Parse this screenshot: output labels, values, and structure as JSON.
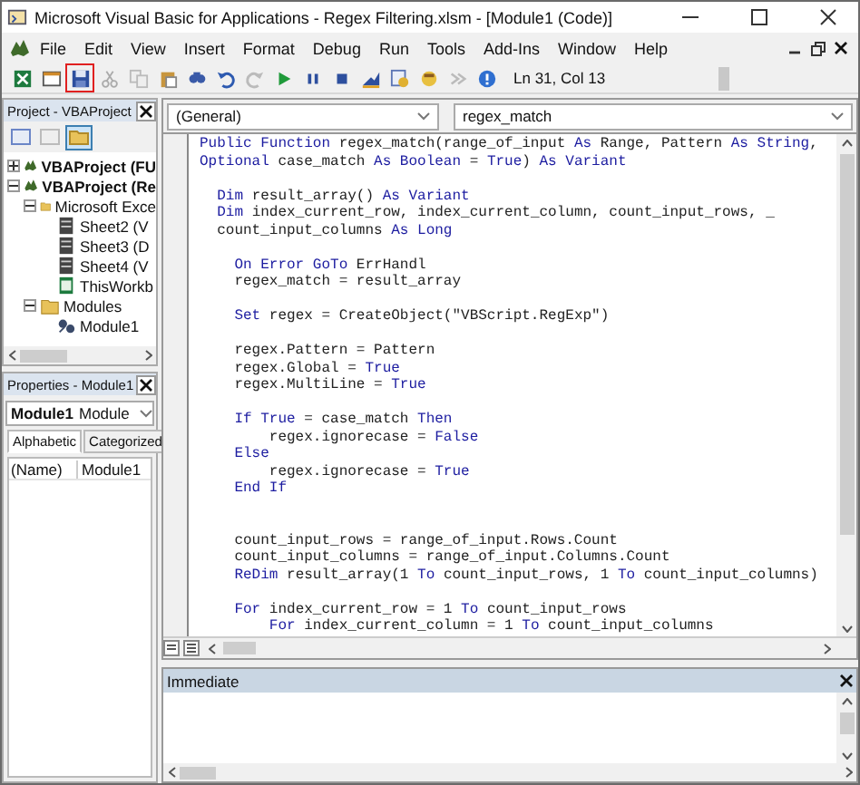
{
  "window": {
    "title": "Microsoft Visual Basic for Applications - Regex Filtering.xlsm - [Module1 (Code)]"
  },
  "menu": [
    "File",
    "Edit",
    "View",
    "Insert",
    "Format",
    "Debug",
    "Run",
    "Tools",
    "Add-Ins",
    "Window",
    "Help"
  ],
  "toolbar": {
    "items": [
      {
        "kind": "excel",
        "highlighted": false
      },
      {
        "kind": "form",
        "highlighted": false
      },
      {
        "kind": "save",
        "highlighted": true
      },
      {
        "kind": "cut",
        "highlighted": false
      },
      {
        "kind": "copy",
        "highlighted": false
      },
      {
        "kind": "paste",
        "highlighted": false
      },
      {
        "kind": "find",
        "highlighted": false
      },
      {
        "kind": "undo",
        "highlighted": false
      },
      {
        "kind": "redo",
        "highlighted": false
      },
      {
        "kind": "run",
        "highlighted": false
      },
      {
        "kind": "pause",
        "highlighted": false
      },
      {
        "kind": "stop",
        "highlighted": false
      },
      {
        "kind": "design",
        "highlighted": false
      },
      {
        "kind": "explorer",
        "highlighted": false
      },
      {
        "kind": "toolbox",
        "highlighted": false
      },
      {
        "kind": "browser",
        "highlighted": false
      },
      {
        "kind": "help",
        "highlighted": false
      }
    ],
    "position": "Ln 31, Col 13"
  },
  "project": {
    "title": "Project - VBAProject",
    "tree": [
      {
        "label": "VBAProject (FU",
        "kind": "project",
        "expanded": false
      },
      {
        "label": "VBAProject (Re",
        "kind": "project",
        "expanded": true,
        "children": [
          {
            "label": "Microsoft Exce",
            "kind": "folder",
            "expanded": true,
            "children": [
              {
                "label": "Sheet2 (V",
                "kind": "sheet"
              },
              {
                "label": "Sheet3 (D",
                "kind": "sheet"
              },
              {
                "label": "Sheet4 (V",
                "kind": "sheet"
              },
              {
                "label": "ThisWorkb",
                "kind": "workbook"
              }
            ]
          },
          {
            "label": "Modules",
            "kind": "folder",
            "expanded": true,
            "children": [
              {
                "label": "Module1",
                "kind": "module"
              }
            ]
          }
        ]
      }
    ]
  },
  "properties": {
    "title": "Properties - Module1",
    "object": {
      "name": "Module1",
      "type": "Module"
    },
    "tabs": [
      {
        "label": "Alphabetic",
        "selected": true
      },
      {
        "label": "Categorized",
        "selected": false
      }
    ],
    "rows": [
      {
        "name": "(Name)",
        "value": "Module1"
      }
    ]
  },
  "code_window": {
    "object_combo": "(General)",
    "procedure_combo": "regex_match",
    "blocks": [
      {
        "lines": [
          [
            {
              "text": "Public Function",
              "kind": "keyword"
            },
            {
              "text": " regex_match(range_of_input ",
              "kind": "plain"
            },
            {
              "text": "As",
              "kind": "keyword"
            },
            {
              "text": " Range, Pattern ",
              "kind": "plain"
            },
            {
              "text": "As String",
              "kind": "keyword"
            },
            {
              "text": ",",
              "kind": "plain"
            }
          ],
          [
            {
              "text": "Optional",
              "kind": "keyword"
            },
            {
              "text": " case_match ",
              "kind": "plain"
            },
            {
              "text": "As Boolean",
              "kind": "keyword"
            },
            {
              "text": " = ",
              "kind": "plain"
            },
            {
              "text": "True",
              "kind": "keyword"
            },
            {
              "text": ") ",
              "kind": "plain"
            },
            {
              "text": "As Variant",
              "kind": "keyword"
            }
          ]
        ]
      },
      {
        "lines": [
          [
            {
              "text": "  Dim",
              "kind": "keyword"
            },
            {
              "text": " result_array() ",
              "kind": "plain"
            },
            {
              "text": "As Variant",
              "kind": "keyword"
            }
          ],
          [
            {
              "text": "  Dim",
              "kind": "keyword"
            },
            {
              "text": " index_current_row, index_current_column, count_input_rows, _",
              "kind": "plain"
            }
          ],
          [
            {
              "text": "  count_input_columns ",
              "kind": "plain"
            },
            {
              "text": "As Long",
              "kind": "keyword"
            }
          ]
        ]
      },
      {
        "lines": [
          [
            {
              "text": "    On Error GoTo",
              "kind": "keyword"
            },
            {
              "text": " ErrHandl",
              "kind": "plain"
            }
          ],
          [
            {
              "text": "    regex_match = result_array",
              "kind": "plain"
            }
          ]
        ]
      },
      {
        "lines": [
          [
            {
              "text": "    Set",
              "kind": "keyword"
            },
            {
              "text": " regex = CreateObject(\"VBScript.RegExp\")",
              "kind": "plain"
            }
          ]
        ]
      },
      {
        "lines": [
          [
            {
              "text": "    regex.Pattern = Pattern",
              "kind": "plain"
            }
          ],
          [
            {
              "text": "    regex.Global = ",
              "kind": "plain"
            },
            {
              "text": "True",
              "kind": "keyword"
            }
          ],
          [
            {
              "text": "    regex.MultiLine = ",
              "kind": "plain"
            },
            {
              "text": "True",
              "kind": "keyword"
            }
          ]
        ]
      },
      {
        "lines": [
          [
            {
              "text": "    If True",
              "kind": "keyword"
            },
            {
              "text": " = case_match ",
              "kind": "plain"
            },
            {
              "text": "Then",
              "kind": "keyword"
            }
          ],
          [
            {
              "text": "        regex.ignorecase = ",
              "kind": "plain"
            },
            {
              "text": "False",
              "kind": "keyword"
            }
          ],
          [
            {
              "text": "    Else",
              "kind": "keyword"
            }
          ],
          [
            {
              "text": "        regex.ignorecase = ",
              "kind": "plain"
            },
            {
              "text": "True",
              "kind": "keyword"
            }
          ],
          [
            {
              "text": "    End If",
              "kind": "keyword"
            }
          ]
        ]
      },
      {
        "wide_gap": true,
        "lines": [
          [
            {
              "text": "    count_input_rows = range_of_input.Rows.Count",
              "kind": "plain"
            }
          ],
          [
            {
              "text": "    count_input_columns = range_of_input.Columns.Count",
              "kind": "plain"
            }
          ],
          [
            {
              "text": "    ReDim",
              "kind": "keyword"
            },
            {
              "text": " result_array(1 ",
              "kind": "plain"
            },
            {
              "text": "To",
              "kind": "keyword"
            },
            {
              "text": " count_input_rows, 1 ",
              "kind": "plain"
            },
            {
              "text": "To",
              "kind": "keyword"
            },
            {
              "text": " count_input_columns)",
              "kind": "plain"
            }
          ]
        ]
      },
      {
        "lines": [
          [
            {
              "text": "    For",
              "kind": "keyword"
            },
            {
              "text": " index_current_row = 1 ",
              "kind": "plain"
            },
            {
              "text": "To",
              "kind": "keyword"
            },
            {
              "text": " count_input_rows",
              "kind": "plain"
            }
          ],
          [
            {
              "text": "        For",
              "kind": "keyword"
            },
            {
              "text": " index_current_column = 1 ",
              "kind": "plain"
            },
            {
              "text": "To",
              "kind": "keyword"
            },
            {
              "text": " count_input_columns",
              "kind": "plain"
            }
          ]
        ]
      }
    ]
  },
  "immediate": {
    "title": "Immediate"
  }
}
